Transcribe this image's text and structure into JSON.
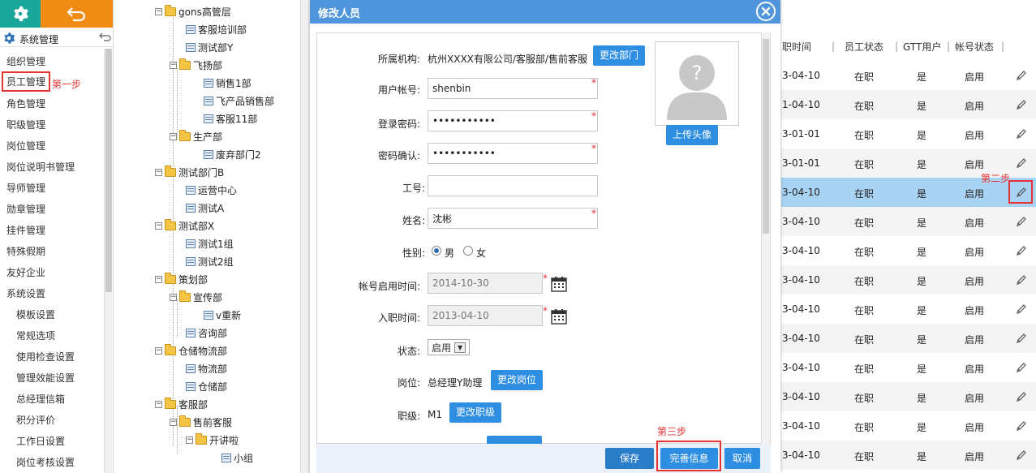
{
  "sidebar": {
    "section_title": "系统管理",
    "step1_label": "第一步",
    "items": [
      {
        "label": "组织管理"
      },
      {
        "label": "员工管理"
      },
      {
        "label": "角色管理"
      },
      {
        "label": "职级管理"
      },
      {
        "label": "岗位管理"
      },
      {
        "label": "岗位说明书管理"
      },
      {
        "label": "导师管理"
      },
      {
        "label": "勋章管理"
      },
      {
        "label": "挂件管理"
      },
      {
        "label": "特殊假期"
      },
      {
        "label": "友好企业"
      },
      {
        "label": "系统设置"
      },
      {
        "label": "模板设置"
      },
      {
        "label": "常规选项"
      },
      {
        "label": "使用检查设置"
      },
      {
        "label": "管理效能设置"
      },
      {
        "label": "总经理信箱"
      },
      {
        "label": "积分评价"
      },
      {
        "label": "工作日设置"
      },
      {
        "label": "岗位考核设置"
      }
    ]
  },
  "tree": {
    "nodes": [
      {
        "label": "gons高管层"
      },
      {
        "label": "客服培训部"
      },
      {
        "label": "测试部Y"
      },
      {
        "label": "飞扬部"
      },
      {
        "label": "销售1部"
      },
      {
        "label": "飞产品销售部"
      },
      {
        "label": "客服11部"
      },
      {
        "label": "生产部"
      },
      {
        "label": "废弃部门2"
      },
      {
        "label": "测试部门B"
      },
      {
        "label": "运营中心"
      },
      {
        "label": "测试A"
      },
      {
        "label": "测试部X"
      },
      {
        "label": "测试1组"
      },
      {
        "label": "测试2组"
      },
      {
        "label": "策划部"
      },
      {
        "label": "宣传部"
      },
      {
        "label": "v重新"
      },
      {
        "label": "咨询部"
      },
      {
        "label": "仓储物流部"
      },
      {
        "label": "物流部"
      },
      {
        "label": "仓储部"
      },
      {
        "label": "客服部"
      },
      {
        "label": "售前客服"
      },
      {
        "label": "开讲啦"
      },
      {
        "label": "小组"
      }
    ]
  },
  "table": {
    "headers": [
      "职时间",
      "员工状态",
      "GTT用户",
      "帐号状态"
    ],
    "step2_label": "第二步",
    "rows": [
      {
        "date": "3-04-10",
        "status": "在职",
        "gtt": "是",
        "account": "启用"
      },
      {
        "date": "1-04-10",
        "status": "在职",
        "gtt": "是",
        "account": "启用"
      },
      {
        "date": "3-01-01",
        "status": "在职",
        "gtt": "是",
        "account": "启用"
      },
      {
        "date": "3-01-01",
        "status": "在职",
        "gtt": "是",
        "account": "启用"
      },
      {
        "date": "3-04-10",
        "status": "在职",
        "gtt": "是",
        "account": "启用"
      },
      {
        "date": "3-04-10",
        "status": "在职",
        "gtt": "是",
        "account": "启用"
      },
      {
        "date": "3-04-10",
        "status": "在职",
        "gtt": "是",
        "account": "启用"
      },
      {
        "date": "3-04-10",
        "status": "在职",
        "gtt": "是",
        "account": "启用"
      },
      {
        "date": "3-04-10",
        "status": "在职",
        "gtt": "是",
        "account": "启用"
      },
      {
        "date": "3-04-10",
        "status": "在职",
        "gtt": "是",
        "account": "启用"
      },
      {
        "date": "3-04-10",
        "status": "在职",
        "gtt": "是",
        "account": "启用"
      },
      {
        "date": "3-04-10",
        "status": "在职",
        "gtt": "是",
        "account": "启用"
      },
      {
        "date": "3-04-10",
        "status": "在职",
        "gtt": "是",
        "account": "启用"
      },
      {
        "date": "3-04-10",
        "status": "在职",
        "gtt": "是",
        "account": "启用"
      }
    ]
  },
  "modal": {
    "title": "修改人员",
    "org_label": "所属机构:",
    "org_value": "杭州XXXX有限公司/客服部/售前客服",
    "change_dept": "更改部门",
    "upload_avatar": "上传头像",
    "account_label": "用户帐号:",
    "account_value": "shenbin",
    "password_label": "登录密码:",
    "password_value": "•••••••••••",
    "confirm_label": "密码确认:",
    "confirm_value": "•••••••••••",
    "empno_label": "工号:",
    "empno_value": "",
    "name_label": "姓名:",
    "name_value": "沈彬",
    "gender_label": "性别:",
    "gender_male": "男",
    "gender_female": "女",
    "enable_date_label": "帐号启用时间:",
    "enable_date_value": "2014-10-30",
    "join_date_label": "入职时间:",
    "join_date_value": "2013-04-10",
    "state_label": "状态:",
    "state_value": "启用",
    "post_label": "岗位:",
    "post_value": "总经理Y助理",
    "change_post": "更改岗位",
    "rank_label": "职级:",
    "rank_value": "M1",
    "change_rank": "更改职级",
    "required_mark": "*",
    "save": "保存",
    "complete": "完善信息",
    "cancel": "取消",
    "step3_label": "第三步"
  },
  "colors": {
    "accent_blue": "#2e8ee2",
    "header_blue": "#4f95db",
    "teal": "#1aa79b",
    "orange": "#f08c13",
    "annotation_red": "#e53333",
    "selected_row": "#a9d3f2"
  }
}
